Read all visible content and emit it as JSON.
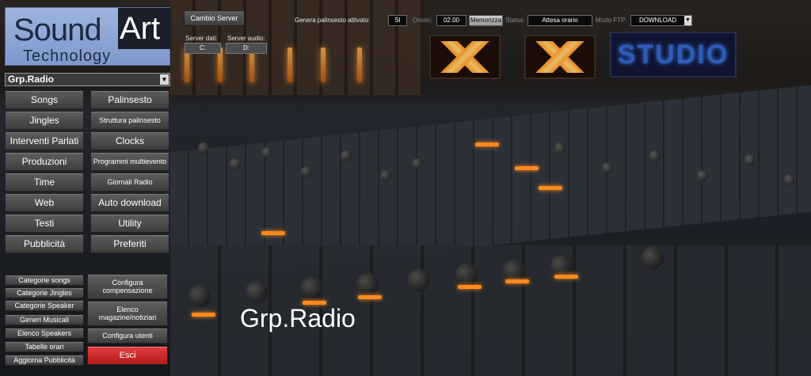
{
  "logo": {
    "word1": "Sound",
    "word2": "Art",
    "word3": "Technology"
  },
  "station_select": {
    "value": "Grp.Radio"
  },
  "left_buttons": [
    "Songs",
    "Jingles",
    "Interventi Parlati",
    "Produzioni",
    "Time",
    "Web",
    "Testi",
    "Pubblicità"
  ],
  "right_buttons": [
    "Palinsesto",
    "Struttura palinsesto",
    "Clocks",
    "Programmi multievento",
    "Giornali Radio",
    "Auto download",
    "Utility",
    "Preferiti"
  ],
  "bottom_left_buttons": [
    "Categorie songs",
    "Categorie Jingles",
    "Categorie Speaker",
    "Generi Musicali",
    "Elenco Speakers",
    "Tabelle orari",
    "Aggiorna Pubblicità"
  ],
  "bottom_right_buttons": {
    "configura_compensazione": "Configura compensazione",
    "elenco_magazine": "Elenco magazine/notiziari",
    "configura_utenti": "Configura utenti",
    "esci": "Esci"
  },
  "toolbar": {
    "cambio_server": "Cambio Server",
    "genera_label": "Genera palinsesto attivato:",
    "genera_value": "SI",
    "orario_label": "Orario:",
    "orario_value": "02.00",
    "memorizza": "Memorizza",
    "status_label": "Status:",
    "status_value": "Attesa orario",
    "ftp_label": "Modo FTP:",
    "ftp_value": "DOWNLOAD"
  },
  "servers": {
    "dati_label": "Server dati:",
    "dati_value": "C:",
    "audio_label": "Server audio:",
    "audio_value": "D:"
  },
  "background_label": "STUDIO",
  "page_title": "Grp.Radio",
  "colors": {
    "accent_red": "#c62020",
    "logo_blue": "#8ea6d6"
  }
}
